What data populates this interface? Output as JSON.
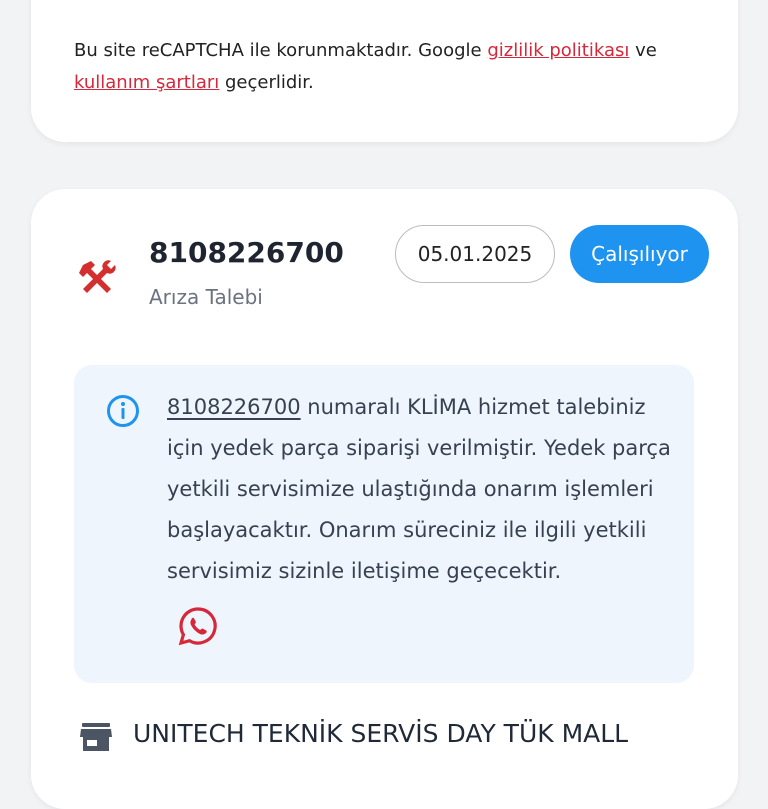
{
  "recaptcha": {
    "text_before": "Bu site reCAPTCHA ile korunmaktadır. Google ",
    "privacy_link": "gizlilik politikası",
    "text_mid": " ve ",
    "terms_link": "kullanım şartları",
    "text_after": " geçerlidir."
  },
  "ticket": {
    "icon": "hammer-wrench-icon",
    "number": "8108226700",
    "type": "Arıza Talebi",
    "date": "05.01.2025",
    "status": "Çalışılıyor"
  },
  "info": {
    "icon": "info-circle-icon",
    "ref_number": "8108226700",
    "message": " numaralı KLİMA hizmet talebiniz için yedek parça siparişi verilmiştir. Yedek parça yetkili servisimize ulaştığında onarım işlemleri başlayacaktır. Onarım süreciniz ile ilgili yetkili servisimiz sizinle iletişime geçecektir.",
    "whatsapp_icon": "whatsapp-icon"
  },
  "service": {
    "icon": "store-icon",
    "name": "UNITECH TEKNİK SERVİS DAY TÜK MALL"
  },
  "colors": {
    "accent_blue": "#1e93f0",
    "link_red": "#d6283a",
    "tool_red": "#d32f2f",
    "info_bg": "#eef5fc"
  }
}
